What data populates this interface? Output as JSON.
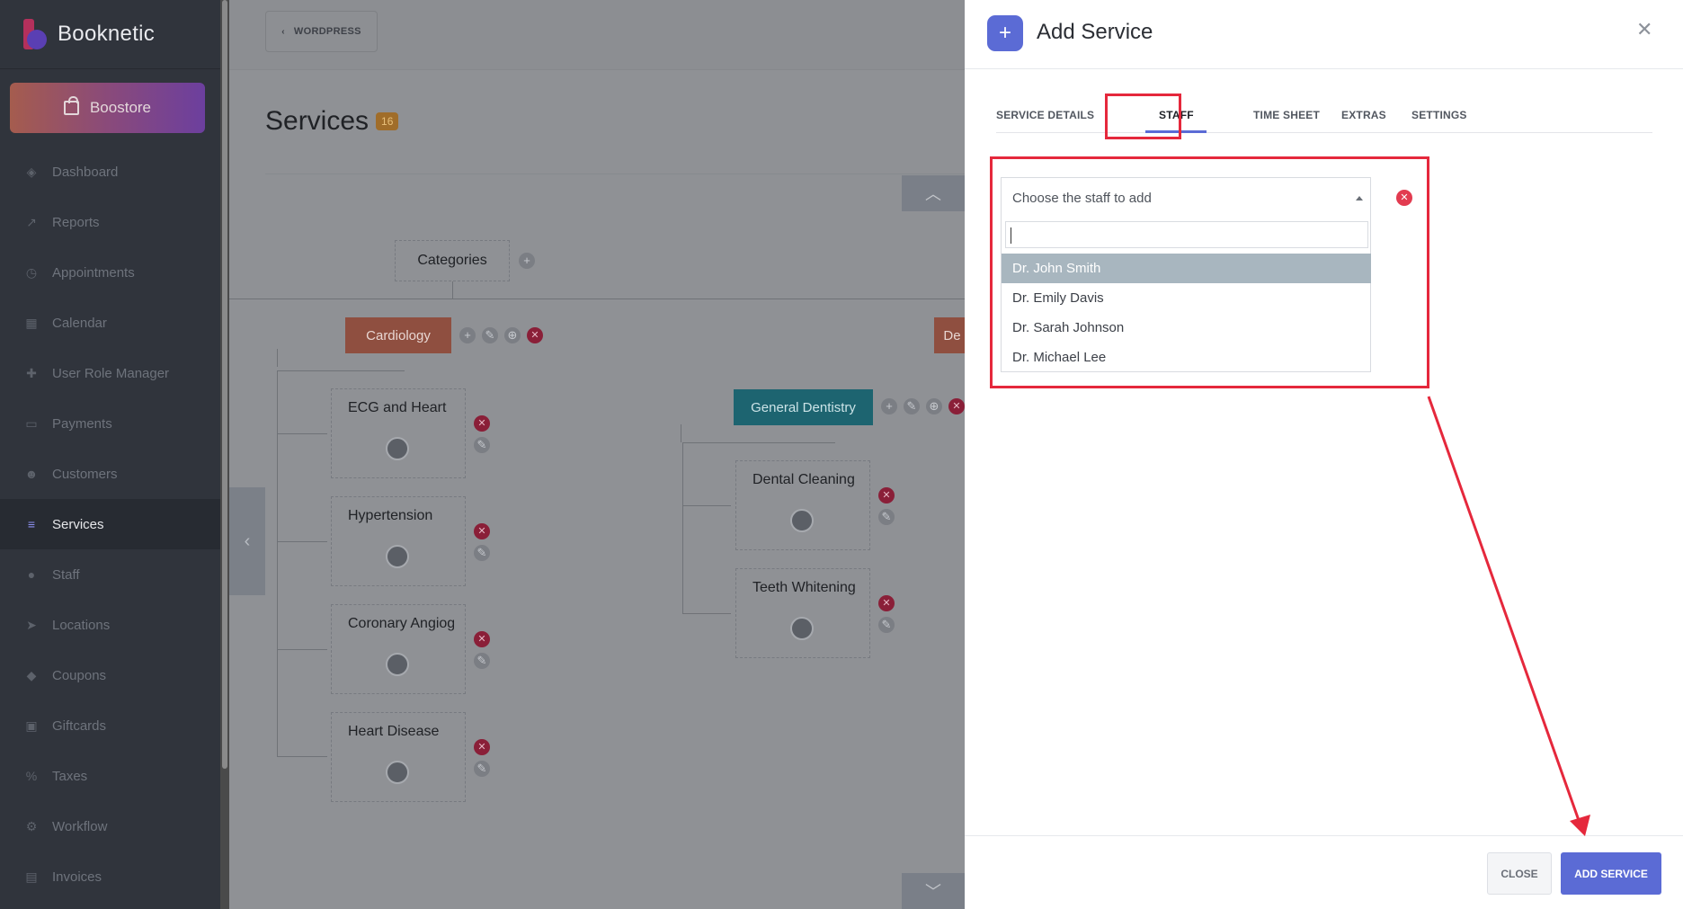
{
  "sidebar": {
    "brand": "Booknetic",
    "boostore": "Boostore",
    "items": [
      {
        "label": "Dashboard",
        "icon": "dashboard-icon",
        "glyph": "◈"
      },
      {
        "label": "Reports",
        "icon": "reports-icon",
        "glyph": "↗"
      },
      {
        "label": "Appointments",
        "icon": "appointments-icon",
        "glyph": "◷"
      },
      {
        "label": "Calendar",
        "icon": "calendar-icon",
        "glyph": "▦"
      },
      {
        "label": "User Role Manager",
        "icon": "user-role-icon",
        "glyph": "✚"
      },
      {
        "label": "Payments",
        "icon": "payments-icon",
        "glyph": "▭"
      },
      {
        "label": "Customers",
        "icon": "customers-icon",
        "glyph": "☻"
      },
      {
        "label": "Services",
        "icon": "services-icon",
        "glyph": "≡"
      },
      {
        "label": "Staff",
        "icon": "staff-icon",
        "glyph": "●"
      },
      {
        "label": "Locations",
        "icon": "locations-icon",
        "glyph": "➤"
      },
      {
        "label": "Coupons",
        "icon": "coupons-icon",
        "glyph": "◆"
      },
      {
        "label": "Giftcards",
        "icon": "giftcards-icon",
        "glyph": "▣"
      },
      {
        "label": "Taxes",
        "icon": "taxes-icon",
        "glyph": "%"
      },
      {
        "label": "Workflow",
        "icon": "workflow-icon",
        "glyph": "⚙"
      },
      {
        "label": "Invoices",
        "icon": "invoices-icon",
        "glyph": "▤"
      }
    ],
    "active": "Services"
  },
  "page": {
    "back_button": "WORDPRESS",
    "title": "Services",
    "count": "16",
    "categories_label": "Categories",
    "category_cardiology": "Cardiology",
    "category_general_dentistry": "General Dentistry",
    "category_partial": "De",
    "cardiology_services": [
      "ECG and Heart",
      "Hypertension",
      "Coronary Angiography",
      "Heart Disease"
    ],
    "dentistry_services": [
      "Dental Cleaning",
      "Teeth Whitening"
    ]
  },
  "modal": {
    "title": "Add Service",
    "tabs": [
      "SERVICE DETAILS",
      "STAFF",
      "TIME SHEET",
      "EXTRAS",
      "SETTINGS"
    ],
    "active_tab": "STAFF",
    "staff_select": {
      "placeholder": "Choose the staff to add",
      "search_value": "",
      "options": [
        "Dr. John Smith",
        "Dr. Emily Davis",
        "Dr. Sarah Johnson",
        "Dr. Michael Lee"
      ],
      "highlighted": "Dr. John Smith"
    },
    "footer": {
      "close": "CLOSE",
      "add": "ADD SERVICE"
    }
  },
  "colors": {
    "accent": "#5b6bd5",
    "highlight": "#e5283c",
    "sidebar_bg": "#30343c"
  }
}
